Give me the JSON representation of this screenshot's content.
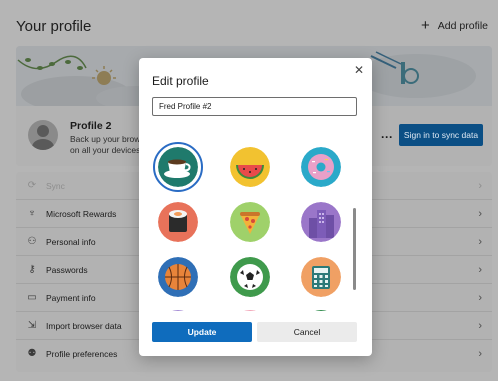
{
  "header": {
    "title": "Your profile",
    "add_profile_label": "Add profile"
  },
  "profile": {
    "name": "Profile 2",
    "description": "Back up your brows... on all your devices.",
    "description_line1": "Back up your brows",
    "description_line2": "on all your devices.",
    "more_label": "···",
    "sync_button_label": "Sign in to sync data"
  },
  "settings": {
    "items": [
      {
        "label": "Sync",
        "icon": "sync-icon",
        "disabled": true
      },
      {
        "label": "Microsoft Rewards",
        "icon": "trophy-icon",
        "disabled": false
      },
      {
        "label": "Personal info",
        "icon": "person-card-icon",
        "disabled": false
      },
      {
        "label": "Passwords",
        "icon": "key-icon",
        "disabled": false
      },
      {
        "label": "Payment info",
        "icon": "credit-card-icon",
        "disabled": false
      },
      {
        "label": "Import browser data",
        "icon": "import-icon",
        "disabled": false
      },
      {
        "label": "Profile preferences",
        "icon": "people-settings-icon",
        "disabled": false
      }
    ]
  },
  "modal": {
    "title": "Edit profile",
    "close_label": "✕",
    "name_value": "Fred Profile #2",
    "update_label": "Update",
    "cancel_label": "Cancel",
    "avatars": [
      {
        "name": "coffee-cup",
        "selected": true
      },
      {
        "name": "watermelon",
        "selected": false
      },
      {
        "name": "donut",
        "selected": false
      },
      {
        "name": "sushi",
        "selected": false
      },
      {
        "name": "pizza",
        "selected": false
      },
      {
        "name": "city-buildings",
        "selected": false
      },
      {
        "name": "basketball",
        "selected": false
      },
      {
        "name": "soccer-ball",
        "selected": false
      },
      {
        "name": "calculator",
        "selected": false
      }
    ]
  },
  "colors": {
    "accent": "#0f6cbd",
    "sync_button": "#0b4f85",
    "selected_ring": "#2a6cc4"
  }
}
